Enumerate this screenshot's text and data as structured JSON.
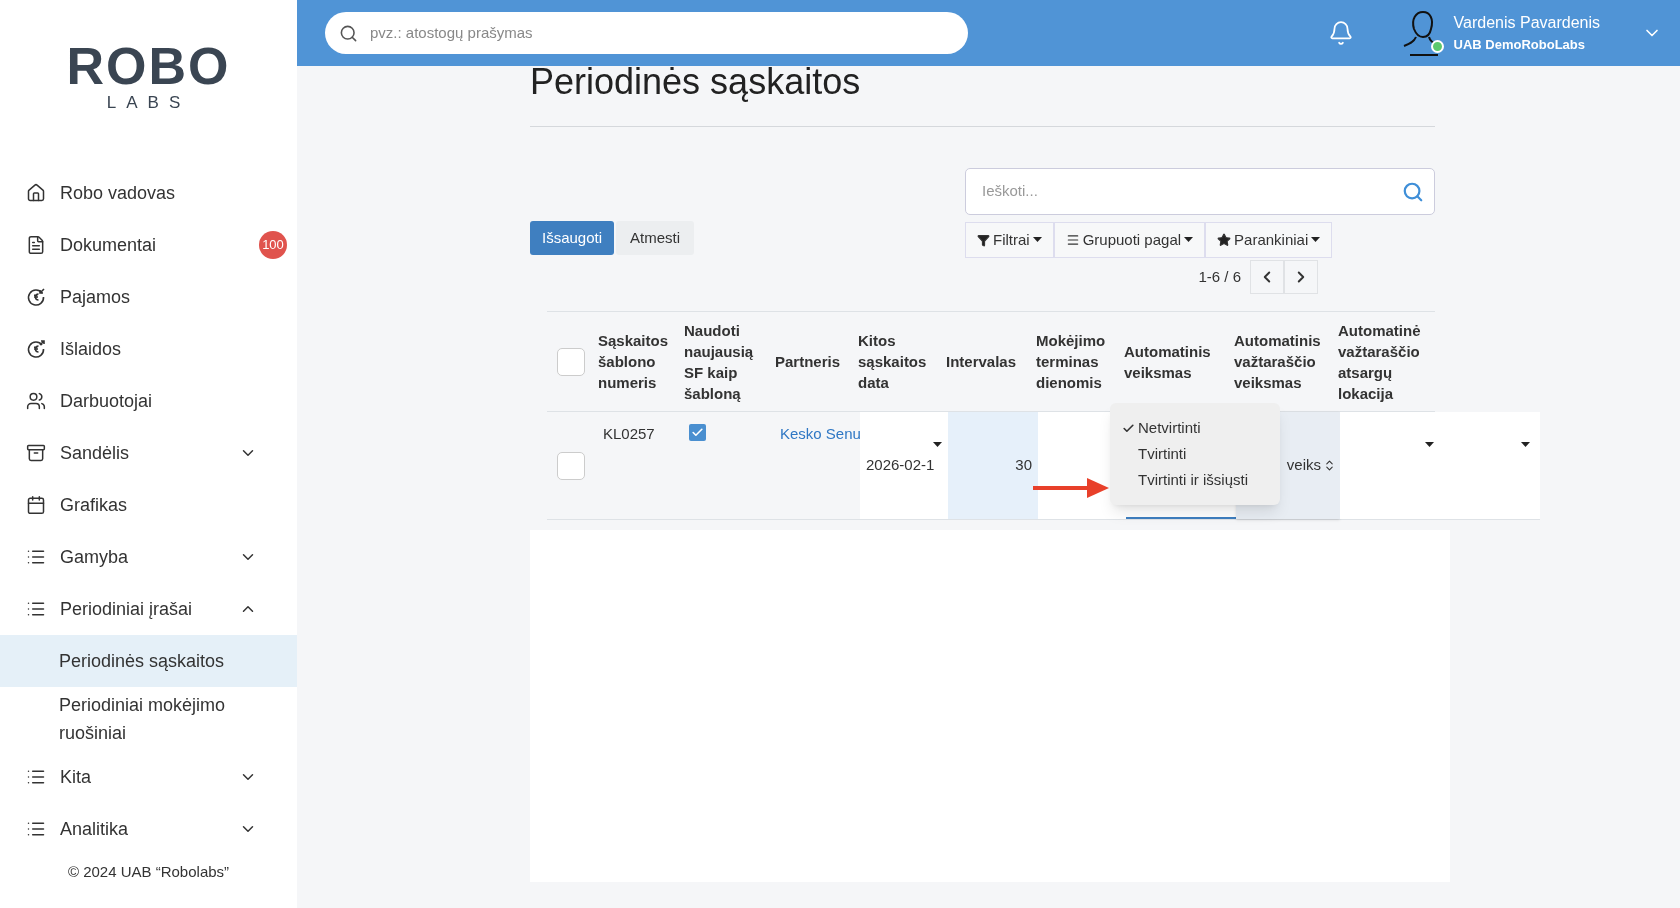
{
  "sidebar": {
    "logo": {
      "top": "ROBO",
      "bottom": "LABS"
    },
    "items": [
      {
        "label": "Robo vadovas",
        "selected": false
      },
      {
        "label": "Dokumentai",
        "badge": "100",
        "selected": false
      },
      {
        "label": "Pajamos",
        "selected": false
      },
      {
        "label": "Išlaidos",
        "selected": false
      },
      {
        "label": "Darbuotojai",
        "selected": false
      },
      {
        "label": "Sandėlis",
        "expanded": false,
        "selected": false
      },
      {
        "label": "Grafikas",
        "selected": false
      },
      {
        "label": "Gamyba",
        "expanded": false,
        "selected": false
      },
      {
        "label": "Periodiniai įrašai",
        "expanded": true,
        "selected": false,
        "children": [
          {
            "label": "Periodinės sąskaitos",
            "selected": true
          },
          {
            "label": "Periodiniai mokėjimo ruošiniai",
            "selected": false
          }
        ]
      },
      {
        "label": "Kita",
        "expanded": false,
        "selected": false
      },
      {
        "label": "Analitika",
        "expanded": false,
        "selected": false
      }
    ],
    "copyright": "© 2024 UAB “Robolabs”"
  },
  "topbar": {
    "search_placeholder": "pvz.: atostogų prašymas",
    "user_name": "Vardenis Pavardenis",
    "company": "UAB DemoRoboLabs",
    "online": true
  },
  "page": {
    "title": "Periodinės sąskaitos",
    "save": "Išsaugoti",
    "discard": "Atmesti",
    "search_placeholder": "Ieškoti...",
    "filters": "Filtrai",
    "group_by": "Grupuoti pagal",
    "favorites": "Parankiniai",
    "pager": "1-6 / 6"
  },
  "table": {
    "select_all_checked": false,
    "columns": [
      "Sąskaitos šablono numeris",
      "Naudoti naujausią SF kaip šabloną",
      "Partneris",
      "Kitos sąskaitos data",
      "Intervalas",
      "Mokėjimo terminas dienomis",
      "Automatinis veiksmas",
      "Automatinis važtaraščio veiksmas",
      "Automatinė važtaraščio atsargų lokacija"
    ],
    "rows": [
      {
        "checked": false,
        "number": "KL0257",
        "use_latest": true,
        "partner": "Kesko Senu",
        "next_date": "2026-02-1",
        "interval": "30",
        "waybill_action": "veiks"
      }
    ]
  },
  "dropdown": {
    "options": [
      {
        "label": "Netvirtinti",
        "selected": true
      },
      {
        "label": "Tvirtinti",
        "selected": false
      },
      {
        "label": "Tvirtinti ir išsiųsti",
        "selected": false
      }
    ]
  }
}
